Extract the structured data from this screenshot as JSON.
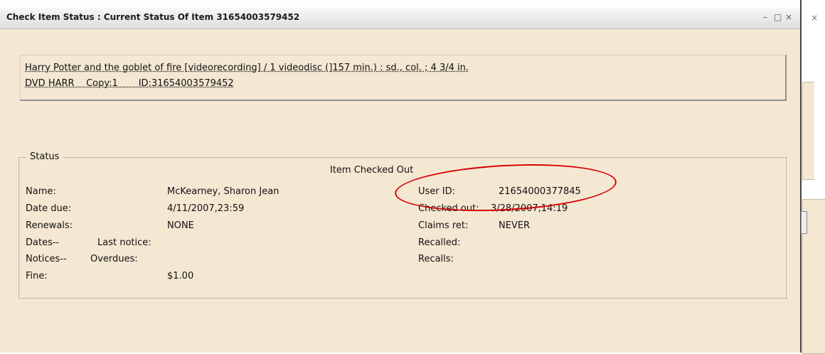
{
  "window": {
    "title": "Check Item Status : Current Status Of Item 31654003579452",
    "controls": {
      "minimize": "–",
      "maximize": "□",
      "close": "×"
    },
    "side_close": "×"
  },
  "item": {
    "line1": "Harry Potter and the goblet of fire [videorecording] / 1 videodisc (]157 min.) : sd., col. ; 4 3/4 in.",
    "line2": "DVD HARR    Copy:1       ID:31654003579452"
  },
  "status": {
    "legend": "Status",
    "heading": "Item Checked Out",
    "name_label": "Name:",
    "name_value": "McKearney, Sharon Jean",
    "date_due_label": "Date due:",
    "date_due_value": "4/11/2007,23:59",
    "renewals_label": "Renewals:",
    "renewals_value": "NONE",
    "dates_label": "Dates--",
    "last_notice_label": "Last notice:",
    "notices_label": "Notices--",
    "overdues_label": "Overdues:",
    "fine_label": "Fine:",
    "fine_value": "$1.00",
    "user_id_label": "User ID:",
    "user_id_value": "21654000377845",
    "checked_out_label": "Checked out:",
    "checked_out_value": "3/28/2007,14:19",
    "claims_ret_label": "Claims ret:",
    "claims_ret_value": "NEVER",
    "recalled_label": "Recalled:",
    "recalls_label": "Recalls:"
  },
  "annotation_color": "#d40000"
}
